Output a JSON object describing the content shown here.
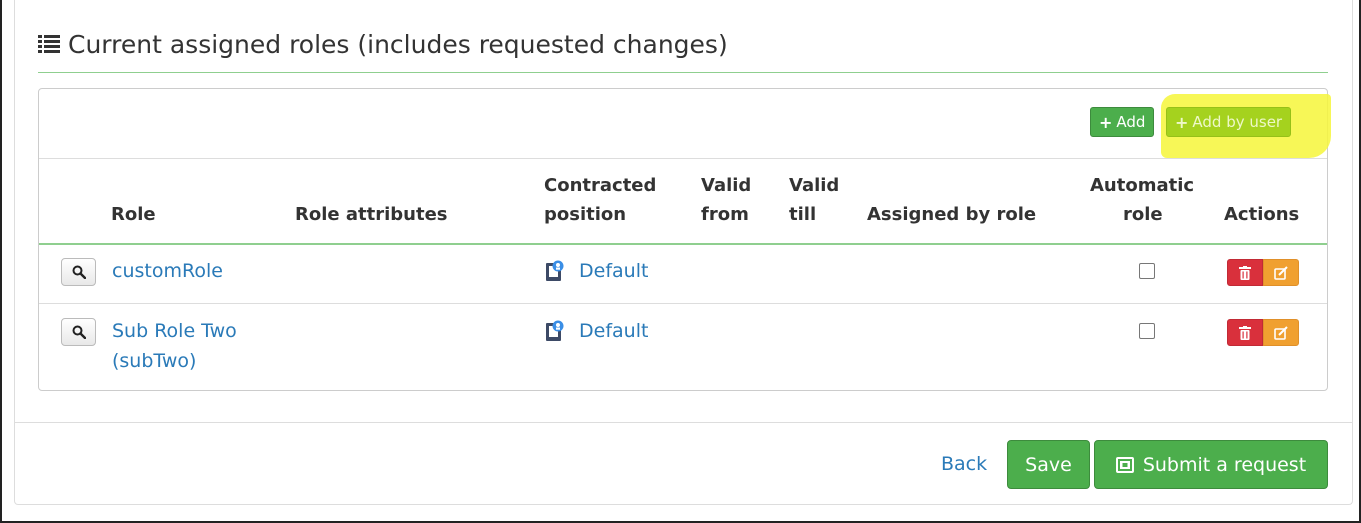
{
  "section": {
    "title": "Current assigned roles (includes requested changes)",
    "title_icon": "list-icon"
  },
  "toolbar": {
    "add_label": "Add",
    "add_by_user_label": "Add by user",
    "highlight_color": "#f6f63a"
  },
  "table": {
    "columns": {
      "role": "Role",
      "role_attributes": "Role attributes",
      "contracted_position_1": "Contracted",
      "contracted_position_2": "position",
      "valid_from_1": "Valid",
      "valid_from_2": "from",
      "valid_till_1": "Valid",
      "valid_till_2": "till",
      "assigned_by_role": "Assigned by role",
      "automatic_role_1": "Automatic",
      "automatic_role_2": "role",
      "actions": "Actions"
    },
    "rows": [
      {
        "role_line1": "customRole",
        "role_line2": "",
        "role_attributes": "",
        "contracted_position": "Default",
        "valid_from": "",
        "valid_till": "",
        "assigned_by_role": "",
        "automatic_role": false
      },
      {
        "role_line1": "Sub Role Two",
        "role_line2": "(subTwo)",
        "role_attributes": "",
        "contracted_position": "Default",
        "valid_from": "",
        "valid_till": "",
        "assigned_by_role": "",
        "automatic_role": false
      }
    ]
  },
  "footer": {
    "back_label": "Back",
    "save_label": "Save",
    "submit_label": "Submit a request"
  },
  "colors": {
    "primary_green": "#4cae4c",
    "lime": "#a5d21e",
    "link_blue": "#2a7ab8",
    "danger_red": "#d9303c",
    "warning_orange": "#f0a030"
  }
}
